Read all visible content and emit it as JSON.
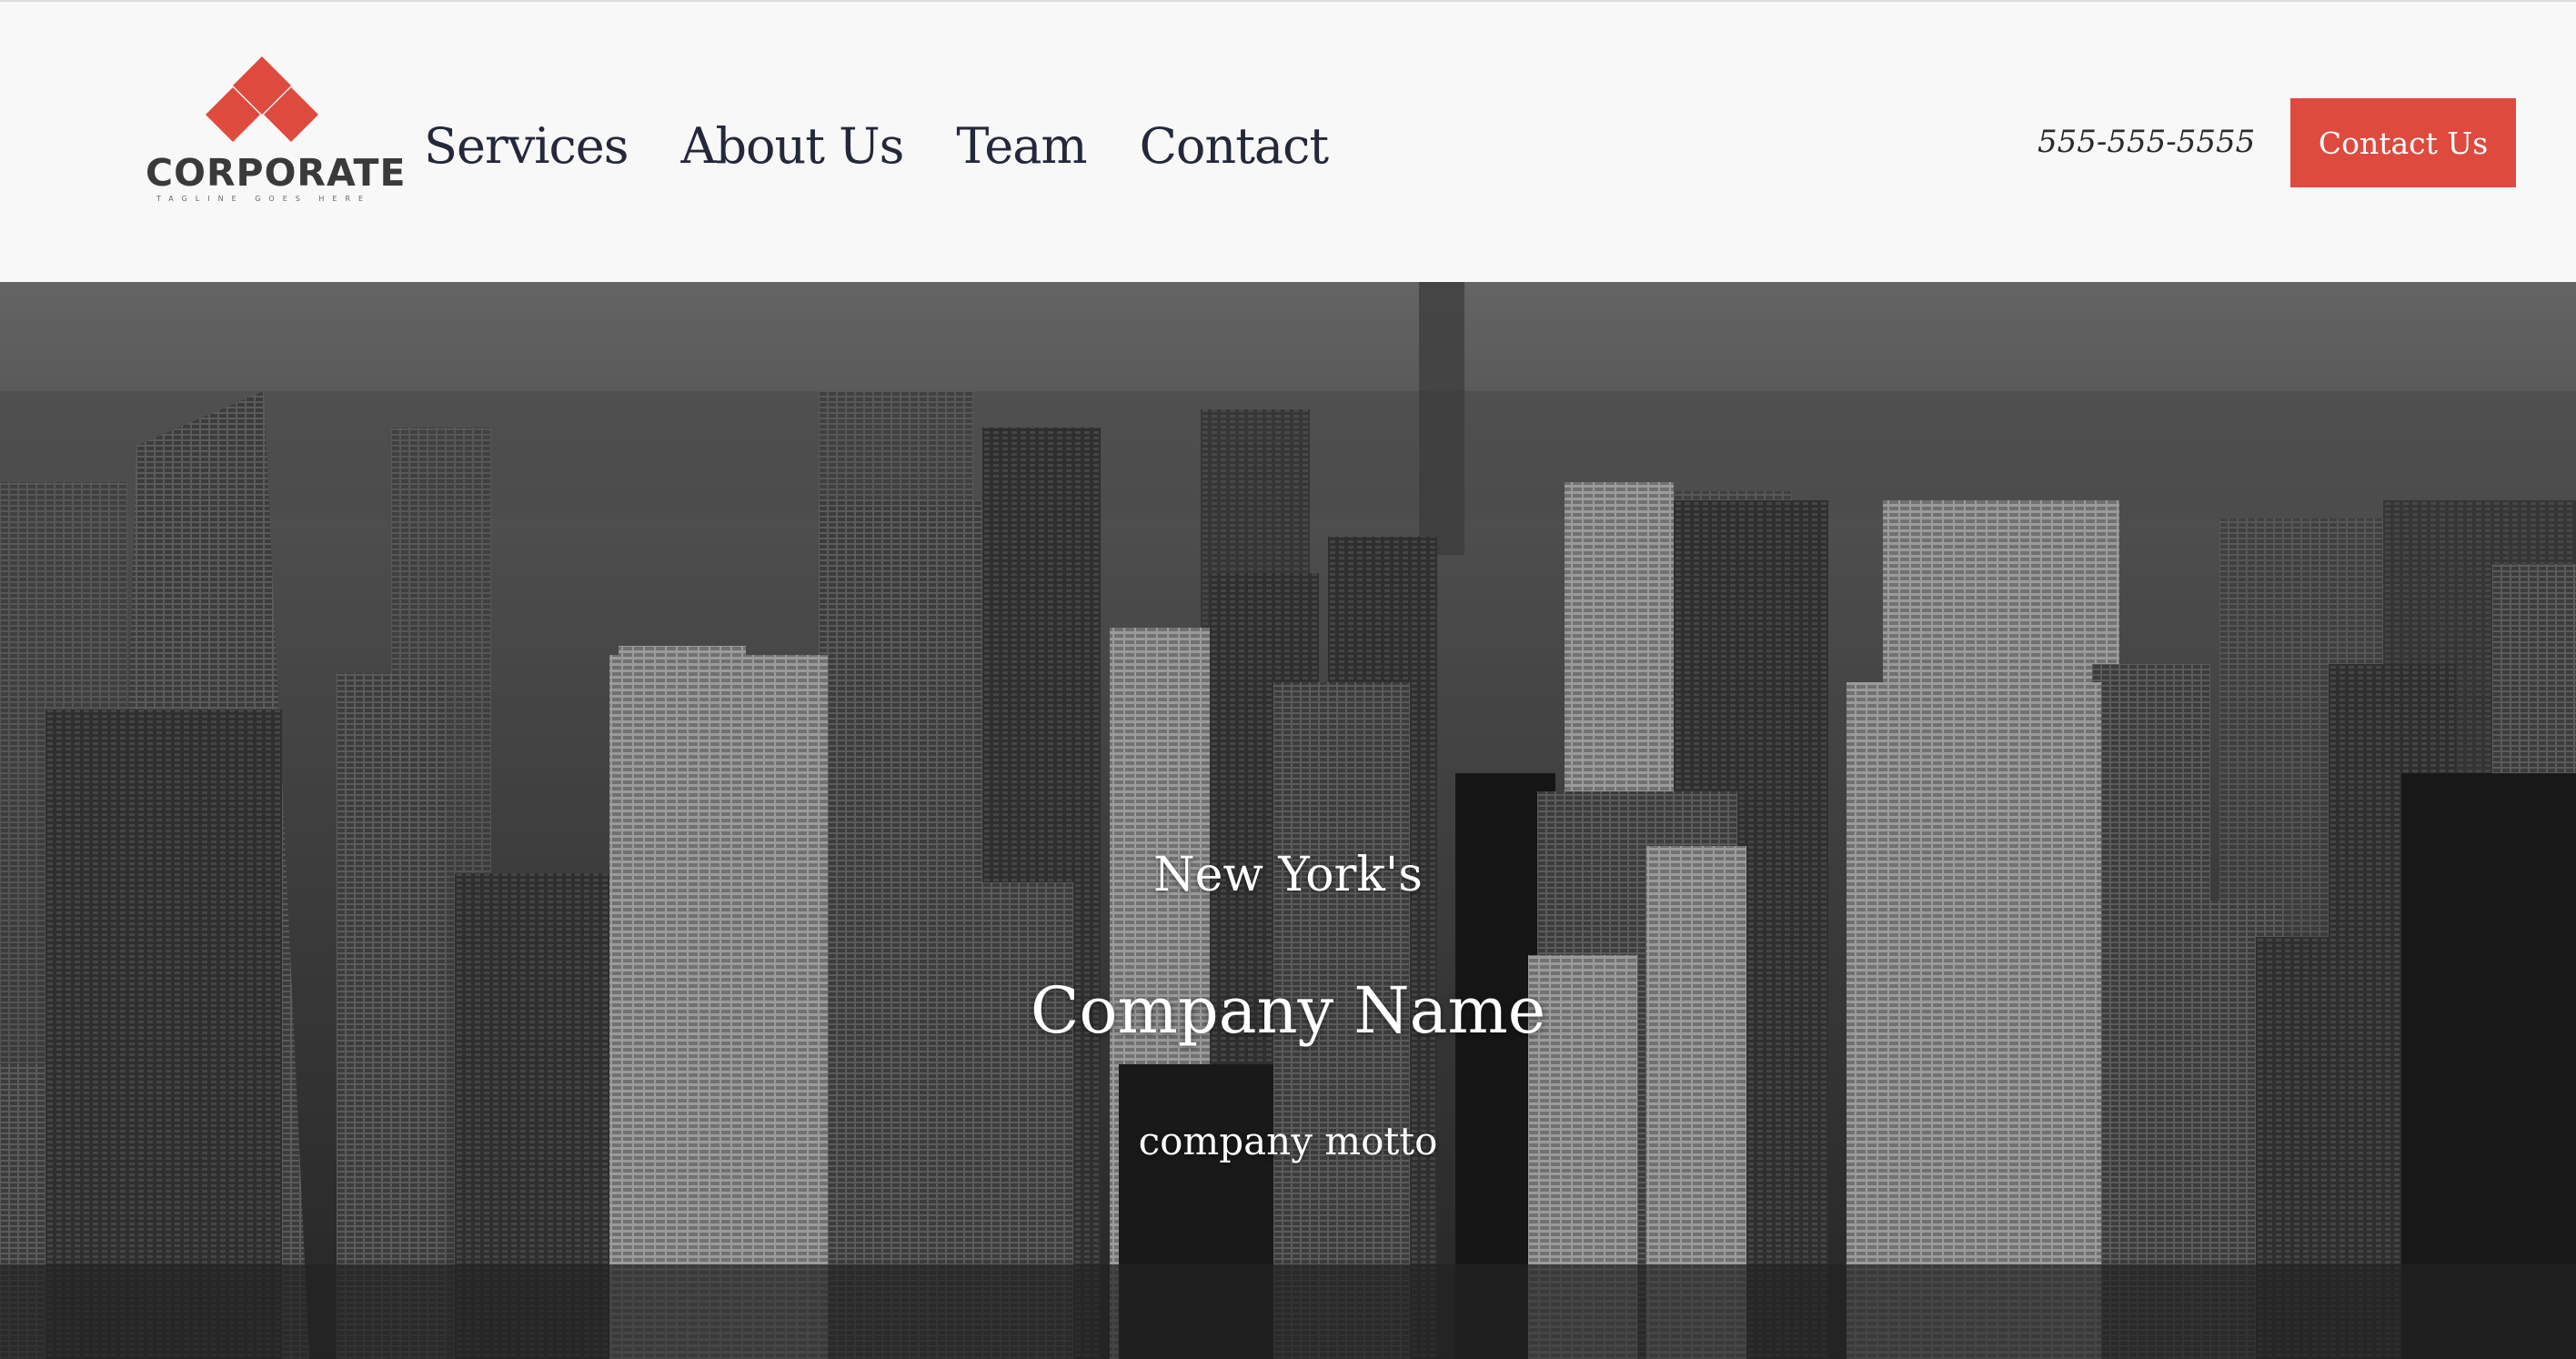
{
  "header": {
    "logo": {
      "wordmark": "CORPORATE",
      "tagline": "TAGLINE GOES HERE",
      "accent_color": "#df4a3e",
      "icon": "four-diamond-logo-icon"
    },
    "nav": [
      {
        "label": "Services"
      },
      {
        "label": "About Us"
      },
      {
        "label": "Team"
      },
      {
        "label": "Contact"
      }
    ],
    "phone": "555-555-5555",
    "cta_label": "Contact Us",
    "cta_color": "#df4a3e"
  },
  "hero": {
    "kicker": "New York's",
    "title": "Company Name",
    "motto": "company motto",
    "background": "new-york-city-skyline-grayscale-image"
  }
}
